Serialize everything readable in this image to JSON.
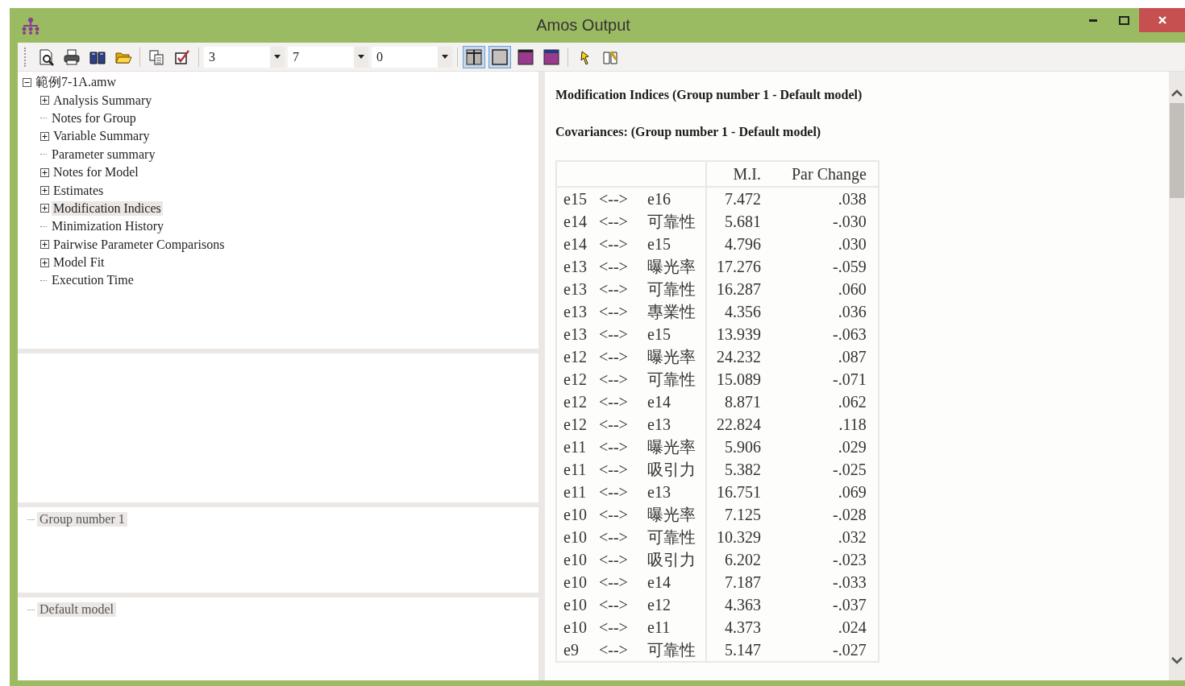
{
  "window": {
    "title": "Amos Output"
  },
  "toolbar": {
    "dropdowns": [
      {
        "value": "3"
      },
      {
        "value": "7"
      },
      {
        "value": "0"
      }
    ],
    "layout_buttons": [
      {
        "selected": true
      },
      {
        "selected": true
      },
      {
        "selected": false
      },
      {
        "selected": false
      }
    ]
  },
  "tree": {
    "label": "範例7-1A.amw",
    "expanded": true,
    "children": [
      {
        "label": "Analysis Summary",
        "kind": "folder",
        "selected": false
      },
      {
        "label": "Notes for Group",
        "kind": "leaf",
        "selected": false
      },
      {
        "label": "Variable Summary",
        "kind": "folder",
        "selected": false
      },
      {
        "label": "Parameter summary",
        "kind": "leaf",
        "selected": false
      },
      {
        "label": "Notes for Model",
        "kind": "folder",
        "selected": false
      },
      {
        "label": "Estimates",
        "kind": "folder",
        "selected": false
      },
      {
        "label": "Modification Indices",
        "kind": "folder",
        "selected": true
      },
      {
        "label": "Minimization History",
        "kind": "leaf",
        "selected": false
      },
      {
        "label": "Pairwise Parameter Comparisons",
        "kind": "folder",
        "selected": false
      },
      {
        "label": "Model Fit",
        "kind": "folder",
        "selected": false
      },
      {
        "label": "Execution Time",
        "kind": "leaf",
        "selected": false
      }
    ]
  },
  "groups": [
    {
      "label": "Group number 1",
      "selected": true
    }
  ],
  "models": [
    {
      "label": "Default model",
      "selected": true
    }
  ],
  "output": {
    "title": "Modification Indices (Group number 1 - Default model)",
    "subtitle": "Covariances: (Group number 1 - Default model)",
    "columns": [
      "M.I.",
      "Par Change"
    ],
    "rows": [
      {
        "from": "e15",
        "arrow": "<-->",
        "to": "e16",
        "mi": "7.472",
        "par_change": ".038"
      },
      {
        "from": "e14",
        "arrow": "<-->",
        "to": "可靠性",
        "mi": "5.681",
        "par_change": "-.030"
      },
      {
        "from": "e14",
        "arrow": "<-->",
        "to": "e15",
        "mi": "4.796",
        "par_change": ".030"
      },
      {
        "from": "e13",
        "arrow": "<-->",
        "to": "曝光率",
        "mi": "17.276",
        "par_change": "-.059"
      },
      {
        "from": "e13",
        "arrow": "<-->",
        "to": "可靠性",
        "mi": "16.287",
        "par_change": ".060"
      },
      {
        "from": "e13",
        "arrow": "<-->",
        "to": "專業性",
        "mi": "4.356",
        "par_change": ".036"
      },
      {
        "from": "e13",
        "arrow": "<-->",
        "to": "e15",
        "mi": "13.939",
        "par_change": "-.063"
      },
      {
        "from": "e12",
        "arrow": "<-->",
        "to": "曝光率",
        "mi": "24.232",
        "par_change": ".087"
      },
      {
        "from": "e12",
        "arrow": "<-->",
        "to": "可靠性",
        "mi": "15.089",
        "par_change": "-.071"
      },
      {
        "from": "e12",
        "arrow": "<-->",
        "to": "e14",
        "mi": "8.871",
        "par_change": ".062"
      },
      {
        "from": "e12",
        "arrow": "<-->",
        "to": "e13",
        "mi": "22.824",
        "par_change": ".118"
      },
      {
        "from": "e11",
        "arrow": "<-->",
        "to": "曝光率",
        "mi": "5.906",
        "par_change": ".029"
      },
      {
        "from": "e11",
        "arrow": "<-->",
        "to": "吸引力",
        "mi": "5.382",
        "par_change": "-.025"
      },
      {
        "from": "e11",
        "arrow": "<-->",
        "to": "e13",
        "mi": "16.751",
        "par_change": ".069"
      },
      {
        "from": "e10",
        "arrow": "<-->",
        "to": "曝光率",
        "mi": "7.125",
        "par_change": "-.028"
      },
      {
        "from": "e10",
        "arrow": "<-->",
        "to": "可靠性",
        "mi": "10.329",
        "par_change": ".032"
      },
      {
        "from": "e10",
        "arrow": "<-->",
        "to": "吸引力",
        "mi": "6.202",
        "par_change": "-.023"
      },
      {
        "from": "e10",
        "arrow": "<-->",
        "to": "e14",
        "mi": "7.187",
        "par_change": "-.033"
      },
      {
        "from": "e10",
        "arrow": "<-->",
        "to": "e12",
        "mi": "4.363",
        "par_change": "-.037"
      },
      {
        "from": "e10",
        "arrow": "<-->",
        "to": "e11",
        "mi": "4.373",
        "par_change": ".024"
      },
      {
        "from": "e9",
        "arrow": "<-->",
        "to": "可靠性",
        "mi": "5.147",
        "par_change": "-.027"
      }
    ]
  }
}
